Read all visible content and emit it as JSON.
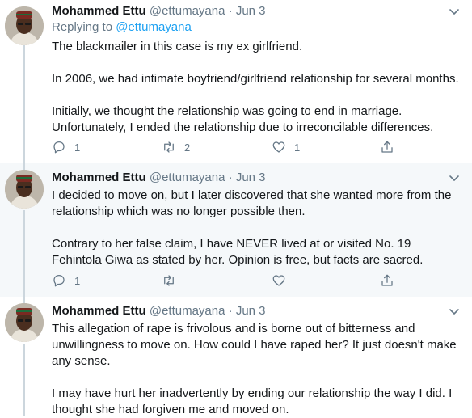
{
  "tweets": [
    {
      "name": "Mohammed Ettu",
      "handle": "@ettumayana",
      "separator": "·",
      "date": "Jun 3",
      "reply_prefix": "Replying to",
      "reply_mention": "@ettumayana",
      "paragraphs": [
        "The blackmailer in this case is my ex girlfriend.",
        "In 2006, we had intimate boyfriend/girlfriend relationship for several months.",
        "Initially, we thought the relationship was going to end in marriage. Unfortunately, I ended the relationship due to irreconcilable differences."
      ],
      "reply_count": "1",
      "retweet_count": "2",
      "like_count": "1"
    },
    {
      "name": "Mohammed Ettu",
      "handle": "@ettumayana",
      "separator": "·",
      "date": "Jun 3",
      "paragraphs": [
        "I decided to move on, but I later discovered that she wanted more from the relationship which was no longer possible then.",
        "Contrary to her false claim, I have NEVER lived at or visited No. 19 Fehintola Giwa as stated by her. Opinion is free, but facts are sacred."
      ],
      "reply_count": "1",
      "retweet_count": "",
      "like_count": ""
    },
    {
      "name": "Mohammed Ettu",
      "handle": "@ettumayana",
      "separator": "·",
      "date": "Jun 3",
      "paragraphs": [
        "This allegation of rape is frivolous and is borne out of bitterness and unwillingness to move on. How could I have raped her? It just doesn't make any sense.",
        "I may have hurt her inadvertently by ending our relationship the way I did. I thought she had forgiven me and moved on."
      ]
    }
  ],
  "icons": {
    "reply": "reply-icon",
    "retweet": "retweet-icon",
    "like": "heart-icon",
    "share": "share-icon",
    "more": "chevron-down-icon"
  },
  "colors": {
    "name": "#14171a",
    "meta": "#657786",
    "link": "#1da1f2",
    "thread_line": "#ccd6dd",
    "highlight_bg": "#f5f8fa"
  }
}
